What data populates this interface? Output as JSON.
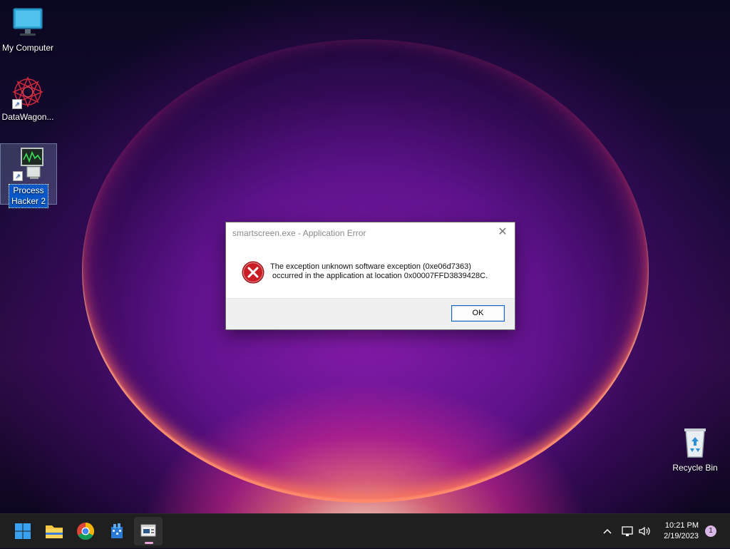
{
  "desktop": {
    "icons": [
      {
        "label": "My Computer"
      },
      {
        "label": "DataWagon..."
      },
      {
        "label": "Process\nHacker 2"
      },
      {
        "label": "Recycle Bin"
      }
    ]
  },
  "dialog": {
    "title": "smartscreen.exe - Application Error",
    "message": "The exception unknown software exception (0xe06d7363)\n occurred in the application at location 0x00007FFD3839428C.",
    "ok_label": "OK",
    "close_icon": "close-icon",
    "error_icon": "error-icon"
  },
  "taskbar": {
    "apps": [
      {
        "name": "start-button",
        "icon": "windows-logo-icon"
      },
      {
        "name": "file-explorer",
        "icon": "folder-icon"
      },
      {
        "name": "chrome",
        "icon": "chrome-icon"
      },
      {
        "name": "app-blue",
        "icon": "app-icon"
      },
      {
        "name": "dialog-window",
        "icon": "window-icon",
        "active": true
      }
    ],
    "time": "10:21 PM",
    "date": "2/19/2023",
    "notification_count": "1"
  },
  "colors": {
    "accent": "#0a64d2",
    "error_red": "#d0202a",
    "taskbar": "#1f1f1f"
  }
}
